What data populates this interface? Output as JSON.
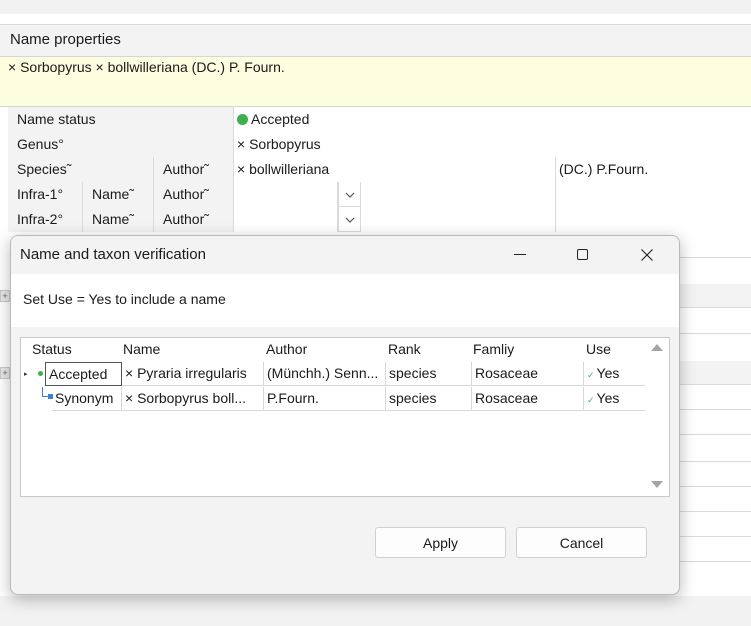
{
  "panel": {
    "title": "Name properties"
  },
  "full_name": "× Sorbopyrus × bollwilleriana (DC.) P. Fourn.",
  "form": {
    "name_status_label": "Name status",
    "name_status_value": "Accepted",
    "genus_label": "Genus°",
    "genus_value": "× Sorbopyrus",
    "species_label": "Species˜",
    "species_author_label": "Author˜",
    "species_value": "× bollwilleriana",
    "species_author_value": "(DC.) P.Fourn.",
    "infra1_label": "Infra-1°",
    "infra1_name_label": "Name˜",
    "infra1_author_label": "Author˜",
    "infra2_label": "Infra-2°",
    "infra2_name_label": "Name˜",
    "infra2_author_label": "Author˜"
  },
  "dialog": {
    "title": "Name and taxon verification",
    "hint": "Set Use = Yes to include a name",
    "columns": [
      "Status",
      "Name",
      "Author",
      "Rank",
      "Famliy",
      "Use"
    ],
    "rows": [
      {
        "status": "Accepted",
        "name": "× Pyraria irregularis",
        "author": "(Münchh.) Senn...",
        "rank": "species",
        "family": "Rosaceae",
        "use": "Yes"
      },
      {
        "status": "Synonym",
        "name": "× Sorbopyrus boll...",
        "author": "P.Fourn.",
        "rank": "species",
        "family": "Rosaceae",
        "use": "Yes"
      }
    ],
    "apply_label": "Apply",
    "cancel_label": "Cancel"
  },
  "icons": {
    "status_dot": "green-status-dot",
    "minimize": "minimize-icon",
    "maximize": "maximize-icon",
    "close": "close-icon"
  },
  "colors": {
    "accepted_dot": "#3cb04a",
    "name_bg": "#fdfde0"
  }
}
